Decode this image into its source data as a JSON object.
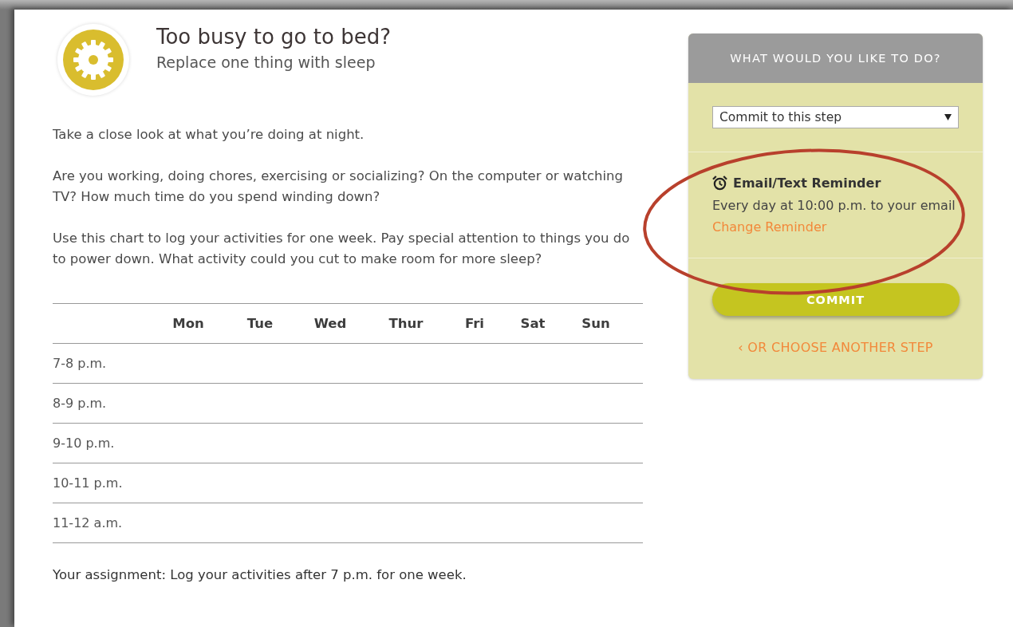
{
  "header": {
    "title": "Too busy to go to bed?",
    "subtitle": "Replace one thing with sleep"
  },
  "paragraphs": [
    "Take a close look at what you’re doing at night.",
    "Are you working, doing chores, exercising or socializing? On the computer or watching TV? How much time do you spend winding down?",
    "Use this chart to log your activities for one week. Pay special attention to things you do to power down. What activity could you cut to make room for more sleep?"
  ],
  "table": {
    "columns": [
      "Mon",
      "Tue",
      "Wed",
      "Thur",
      "Fri",
      "Sat",
      "Sun"
    ],
    "rows": [
      "7-8 p.m.",
      "8-9 p.m.",
      "9-10 p.m.",
      "10-11 p.m.",
      "11-12 a.m."
    ]
  },
  "assignment": "Your assignment: Log your activities after 7 p.m. for one week.",
  "panel": {
    "title": "WHAT WOULD YOU LIKE TO DO?",
    "select": {
      "value": "Commit to this step"
    },
    "reminder": {
      "title": "Email/Text Reminder",
      "text": "Every day at 10:00 p.m. to your email",
      "link": "Change Reminder"
    },
    "button": "COMMIT",
    "back_link": "‹ OR CHOOSE ANOTHER STEP"
  }
}
